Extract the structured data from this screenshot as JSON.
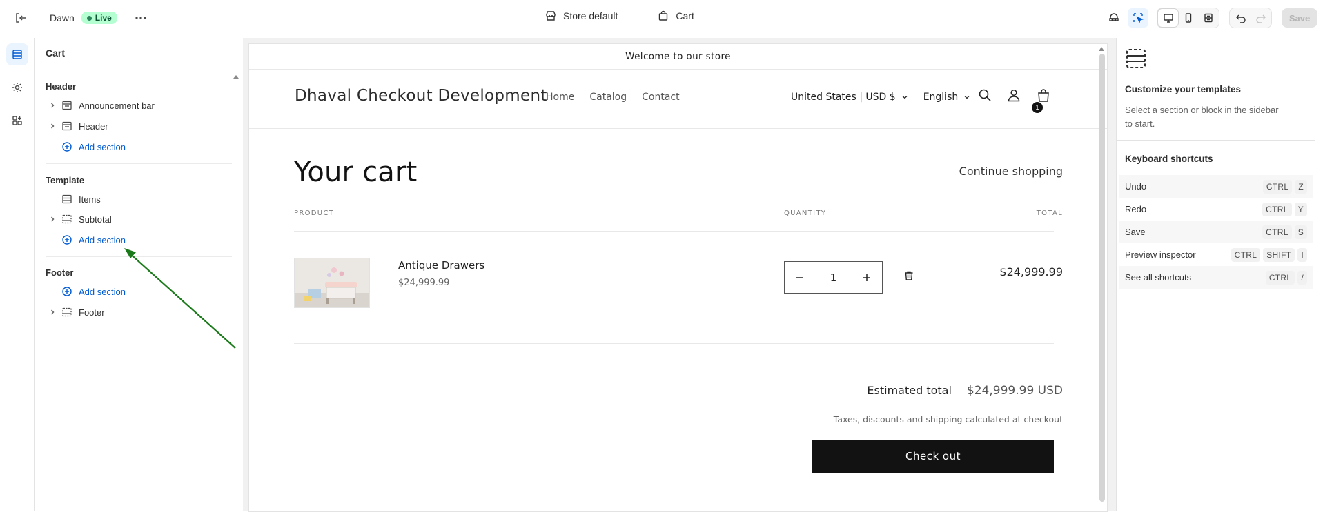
{
  "topbar": {
    "theme_name": "Dawn",
    "live_label": "Live",
    "store_default_label": "Store default",
    "page_label": "Cart",
    "save_label": "Save"
  },
  "sidebar": {
    "title": "Cart",
    "groups": [
      {
        "label": "Header",
        "items": [
          {
            "label": "Announcement bar"
          },
          {
            "label": "Header"
          }
        ],
        "add_label": "Add section"
      },
      {
        "label": "Template",
        "items": [
          {
            "label": "Items"
          },
          {
            "label": "Subtotal"
          }
        ],
        "add_label": "Add section"
      },
      {
        "label": "Footer",
        "items": [
          {
            "label": "Footer"
          }
        ],
        "add_label": "Add section"
      }
    ]
  },
  "preview": {
    "announcement": "Welcome to our store",
    "store_name": "Dhaval Checkout Development",
    "nav": [
      "Home",
      "Catalog",
      "Contact"
    ],
    "country": "United States | USD $",
    "language": "English",
    "cart_count": "1",
    "cart_title": "Your cart",
    "continue_shopping": "Continue shopping",
    "columns": {
      "product": "PRODUCT",
      "quantity": "QUANTITY",
      "total": "TOTAL"
    },
    "item": {
      "name": "Antique Drawers",
      "price": "$24,999.99",
      "quantity": "1",
      "line_total": "$24,999.99"
    },
    "estimated_label": "Estimated total",
    "estimated_value": "$24,999.99 USD",
    "tax_note": "Taxes, discounts and shipping calculated at checkout",
    "checkout_label": "Check out"
  },
  "right_panel": {
    "title": "Customize your templates",
    "description": "Select a section or block in the sidebar to start.",
    "shortcuts_title": "Keyboard shortcuts",
    "shortcuts": [
      {
        "label": "Undo",
        "keys": [
          "CTRL",
          "Z"
        ]
      },
      {
        "label": "Redo",
        "keys": [
          "CTRL",
          "Y"
        ]
      },
      {
        "label": "Save",
        "keys": [
          "CTRL",
          "S"
        ]
      },
      {
        "label": "Preview inspector",
        "keys": [
          "CTRL",
          "SHIFT",
          "I"
        ]
      },
      {
        "label": "See all shortcuts",
        "keys": [
          "CTRL",
          "/"
        ]
      }
    ]
  },
  "colors": {
    "accent": "#005bd3",
    "live_bg": "#b4fed2",
    "annotation_arrow": "#1a7a1a",
    "checkout_bg": "#121212"
  }
}
